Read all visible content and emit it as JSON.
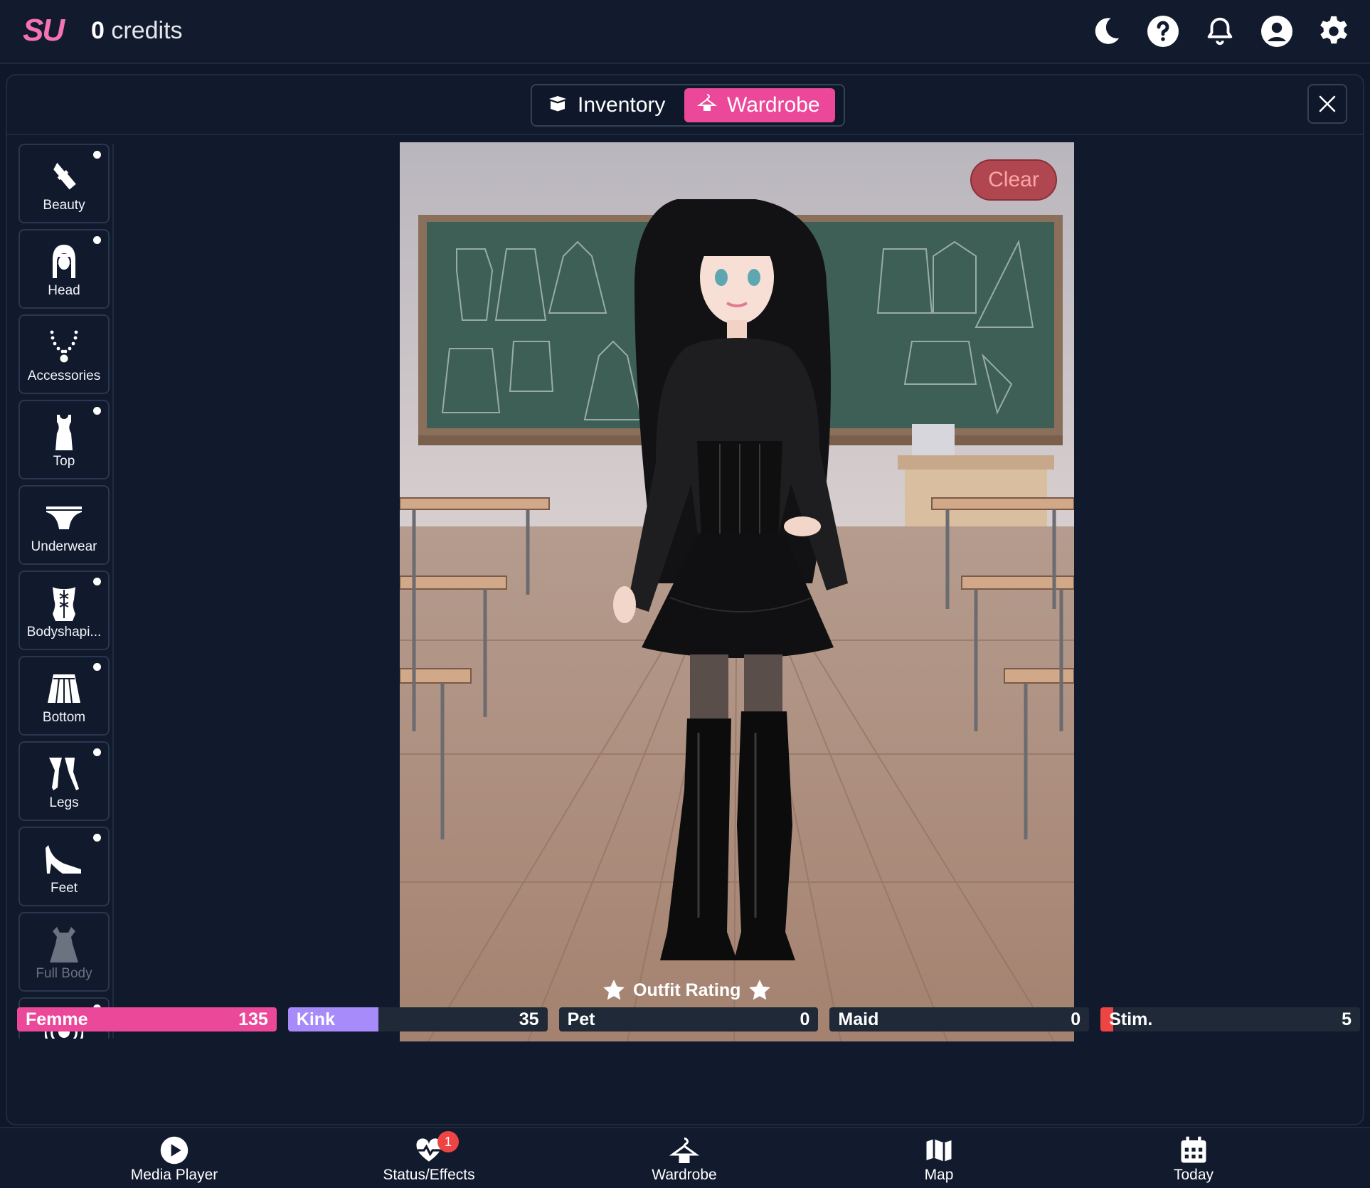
{
  "header": {
    "logo": "SU",
    "credits_value": "0",
    "credits_label": "credits",
    "icons": [
      "moon-icon",
      "help-icon",
      "bell-icon",
      "user-icon",
      "gear-icon"
    ]
  },
  "tabs": {
    "inventory": "Inventory",
    "wardrobe": "Wardrobe",
    "active": "wardrobe"
  },
  "sidebar": {
    "items": [
      {
        "label": "Beauty",
        "icon": "lipstick-icon",
        "dot": true
      },
      {
        "label": "Head",
        "icon": "hair-head-icon",
        "dot": true
      },
      {
        "label": "Accessories",
        "icon": "necklace-icon",
        "dot": false
      },
      {
        "label": "Top",
        "icon": "tank-top-icon",
        "dot": true
      },
      {
        "label": "Underwear",
        "icon": "underwear-icon",
        "dot": false
      },
      {
        "label": "Bodyshapi...",
        "icon": "corset-icon",
        "dot": true
      },
      {
        "label": "Bottom",
        "icon": "skirt-icon",
        "dot": true
      },
      {
        "label": "Legs",
        "icon": "stockings-icon",
        "dot": true
      },
      {
        "label": "Feet",
        "icon": "high-heel-icon",
        "dot": true
      },
      {
        "label": "Full Body",
        "icon": "dress-icon",
        "dot": false,
        "disabled": true
      },
      {
        "label": "",
        "icon": "vibration-icon",
        "dot": true
      }
    ]
  },
  "scene": {
    "clear_label": "Clear"
  },
  "rating": {
    "title": "Outfit Rating",
    "stats": [
      {
        "name": "Femme",
        "value": "135",
        "fill": 1.0,
        "color": "#ec4899"
      },
      {
        "name": "Kink",
        "value": "35",
        "fill": 0.35,
        "color": "#a78bfa"
      },
      {
        "name": "Pet",
        "value": "0",
        "fill": 0.0,
        "color": "#22c55e"
      },
      {
        "name": "Maid",
        "value": "0",
        "fill": 0.0,
        "color": "#38bdf8"
      },
      {
        "name": "Stim.",
        "value": "5",
        "fill": 0.05,
        "color": "#ef4444"
      }
    ]
  },
  "bottom_nav": {
    "items": [
      {
        "label": "Media Player",
        "icon": "play-icon"
      },
      {
        "label": "Status/Effects",
        "icon": "heart-pulse-icon",
        "badge": "1"
      },
      {
        "label": "Wardrobe",
        "icon": "hanger-icon"
      },
      {
        "label": "Map",
        "icon": "map-icon"
      },
      {
        "label": "Today",
        "icon": "calendar-icon"
      }
    ]
  },
  "colors": {
    "accent": "#ec4899",
    "background": "#0f172a",
    "panel": "#111a2d",
    "clear_button": "#b04750"
  }
}
